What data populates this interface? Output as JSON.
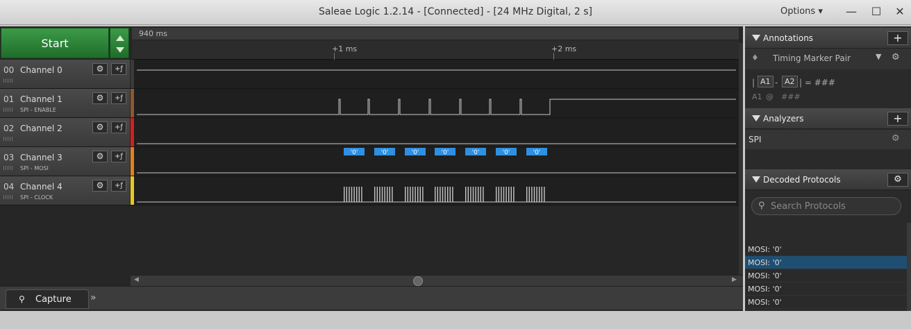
{
  "window": {
    "title": "Saleae Logic 1.2.14 - [Connected] - [24 MHz Digital, 2 s]",
    "options_label": "Options",
    "minimize": "—",
    "maximize": "☐",
    "close": "✕"
  },
  "toolbar": {
    "start_label": "Start"
  },
  "ruler": {
    "start_time": "940 ms",
    "ticks": [
      "+1 ms",
      "+2 ms"
    ]
  },
  "channels": [
    {
      "num": "00",
      "name": "Channel 0",
      "sub": "",
      "color": "#3a3a3a"
    },
    {
      "num": "01",
      "name": "Channel 1",
      "sub": "SPI - ENABLE",
      "color": "#8a5a2e"
    },
    {
      "num": "02",
      "name": "Channel 2",
      "sub": "",
      "color": "#d02020"
    },
    {
      "num": "03",
      "name": "Channel 3",
      "sub": "SPI - MOSI",
      "color": "#e08020"
    },
    {
      "num": "04",
      "name": "Channel 4",
      "sub": "SPI - CLOCK",
      "color": "#e8c820"
    }
  ],
  "mosi_labels": [
    "'0'",
    "'0'",
    "'0'",
    "'0'",
    "'0'",
    "'0'",
    "'0'"
  ],
  "tabs": {
    "capture": "Capture",
    "more": "»"
  },
  "annotations": {
    "title": "Annotations",
    "add": "+",
    "marker_label": "Timing Marker Pair",
    "a1": "A1",
    "a2": "A2",
    "dash": "-",
    "eq": "| = ###",
    "pipe": "|",
    "a1_at": "A1",
    "at": "@",
    "hash": "###"
  },
  "analyzers": {
    "title": "Analyzers",
    "add": "+",
    "items": [
      "SPI"
    ]
  },
  "decoded": {
    "title": "Decoded Protocols",
    "search_placeholder": "Search Protocols",
    "items": [
      "MOSI: '0'",
      "MOSI: '0'",
      "MOSI: '0'",
      "MOSI: '0'",
      "MOSI: '0'",
      "MOSI: '0'",
      "MOSI: '0'"
    ],
    "selected_index": 1
  },
  "colors": {
    "accent_green": "#2e8a3a",
    "mosi_box": "#2f8fe0",
    "selected_row": "#1e4f73"
  }
}
